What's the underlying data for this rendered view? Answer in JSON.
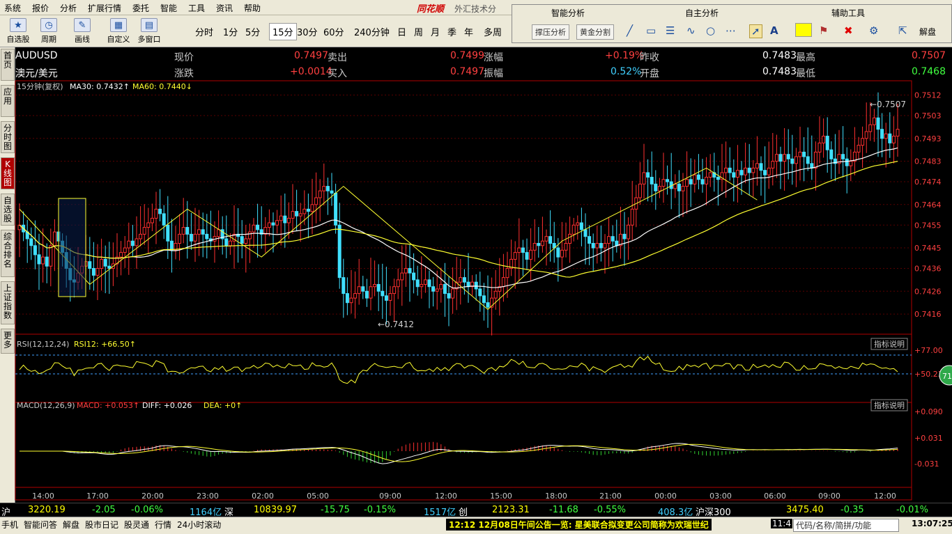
{
  "menu": {
    "items": [
      "系统",
      "报价",
      "分析",
      "扩展行情",
      "委托",
      "智能",
      "工具",
      "资讯",
      "帮助"
    ],
    "brand": "同花顺",
    "title": "外汇技术分"
  },
  "toolbar": {
    "buttons": [
      {
        "label": "自选股",
        "icon": "★"
      },
      {
        "label": "周期",
        "icon": "◷"
      },
      {
        "label": "画线",
        "icon": "✎"
      },
      {
        "label": "自定义",
        "icon": "▦"
      },
      {
        "label": "多窗口",
        "icon": "▤"
      }
    ],
    "periods": [
      "分时",
      "1分",
      "5分",
      "15分",
      "30分",
      "60分",
      "240分钟",
      "日",
      "周",
      "月",
      "季",
      "年",
      "多周"
    ],
    "active_period": "15分"
  },
  "panel": {
    "smart": "智能分析",
    "self": "自主分析",
    "aux": "辅助工具",
    "btn1": "撑压分析",
    "btn2": "黄金分割",
    "text_tool": "A",
    "layout": "解盘"
  },
  "left_tabs": [
    "首页",
    "应用",
    "分时图",
    "K线图",
    "自选股",
    "综合排名",
    "上证指数",
    "更多"
  ],
  "quote": {
    "code": "AUDUSD",
    "name": "澳元/美元",
    "labels": [
      "现价",
      "卖出",
      "涨幅",
      "昨收",
      "最高",
      "涨跌",
      "买入",
      "振幅",
      "开盘",
      "最低"
    ],
    "now": "0.7497",
    "sell": "0.7499",
    "pct": "+0.19%",
    "prev": "0.7483",
    "high": "0.7507",
    "chg": "+0.0014",
    "buy": "0.7497",
    "amp": "0.52%",
    "open": "0.7483",
    "low": "0.7468"
  },
  "main_legend": {
    "period": "15分钟(复权)",
    "ma30": "MA30: 0.7432",
    "ma60": "MA60: 0.7440"
  },
  "annotations": {
    "hi": "0.7507",
    "lo": "0.7412"
  },
  "rsi_legend": {
    "name": "RSI(12,12,24)",
    "val": "RSI12: +66.50",
    "help": "指标说明",
    "badge": "71"
  },
  "macd_legend": {
    "name": "MACD(12,26,9)",
    "macd": "MACD: +0.053",
    "diff": "DIFF: +0.026",
    "dea": "DEA: +0",
    "help": "指标说明"
  },
  "status": {
    "sh_label": "沪",
    "sh_idx": "3220.19",
    "sh_chg": "-2.05",
    "sh_pct": "-0.06%",
    "sh_amt": "1164亿",
    "sz_label": "深",
    "sz_idx": "10839.97",
    "sz_chg": "-15.75",
    "sz_pct": "-0.15%",
    "sz_amt": "1517亿",
    "cy_label": "创",
    "cy_idx": "2123.31",
    "cy_chg": "-11.68",
    "cy_pct": "-0.55%",
    "cy_amt": "408.3亿",
    "hs_label": "沪深300",
    "hs_idx": "3475.40",
    "hs_chg": "-0.35",
    "hs_pct": "-0.01%"
  },
  "taskbar": {
    "items": [
      "手机",
      "智能问答",
      "解盘",
      "股市日记",
      "股灵通",
      "行情",
      "24小时滚动"
    ],
    "news": "12:12 12月08日午间公告一览: 星美联合拟变更公司简称为欢瑞世纪",
    "time_short": "11:4",
    "search": "代码/名称/简拼/功能",
    "clock": "13:07:25"
  },
  "chart_data": {
    "type": "candlestick",
    "symbol": "AUDUSD",
    "x_ticks": [
      "14:00",
      "17:00",
      "20:00",
      "23:00",
      "02:00",
      "05:00",
      "09:00",
      "12:00",
      "15:00",
      "18:00",
      "21:00",
      "00:00",
      "03:00",
      "06:00",
      "09:00",
      "12:00"
    ],
    "y_ticks": [
      "0.7512",
      "0.7503",
      "0.7493",
      "0.7483",
      "0.7474",
      "0.7464",
      "0.7455",
      "0.7445",
      "0.7436",
      "0.7426",
      "0.7416"
    ],
    "ylim": [
      0.7409,
      0.7514
    ],
    "close": [
      0.7455,
      0.7452,
      0.7449,
      0.7446,
      0.7442,
      0.7438,
      0.7441,
      0.7437,
      0.7446,
      0.7452,
      0.7448,
      0.7443,
      0.7436,
      0.7431,
      0.743,
      0.7434,
      0.7437,
      0.7439,
      0.7436,
      0.7433,
      0.7436,
      0.744,
      0.7437,
      0.7436,
      0.7438,
      0.7441,
      0.7443,
      0.7445,
      0.7448,
      0.7446,
      0.7449,
      0.7451,
      0.7454,
      0.7456,
      0.7458,
      0.7462,
      0.746,
      0.7455,
      0.7448,
      0.7444,
      0.7447,
      0.7451,
      0.7454,
      0.7451,
      0.7448,
      0.7451,
      0.7453,
      0.7451,
      0.7449,
      0.7448,
      0.745,
      0.7453,
      0.7449,
      0.7446,
      0.7448,
      0.7451,
      0.745,
      0.7447,
      0.7449,
      0.7452,
      0.7455,
      0.7453,
      0.7451,
      0.7454,
      0.7456,
      0.7455,
      0.7457,
      0.7459,
      0.7456,
      0.7458,
      0.7461,
      0.7459,
      0.746,
      0.7462,
      0.7461,
      0.7464,
      0.7467,
      0.747,
      0.7472,
      0.747,
      0.7469,
      0.7455,
      0.7432,
      0.7425,
      0.7421,
      0.7423,
      0.7425,
      0.7428,
      0.7426,
      0.7423,
      0.7428,
      0.7429,
      0.7426,
      0.7424,
      0.7422,
      0.7425,
      0.7428,
      0.7431,
      0.7434,
      0.7436,
      0.7434,
      0.7431,
      0.7428,
      0.7429,
      0.7431,
      0.7428,
      0.7426,
      0.7427,
      0.7429,
      0.7425,
      0.7423,
      0.7427,
      0.743,
      0.7432,
      0.743,
      0.7428,
      0.743,
      0.7427,
      0.7424,
      0.7421,
      0.7419,
      0.7423,
      0.7426,
      0.7428,
      0.7432,
      0.7436,
      0.744,
      0.7443,
      0.7445,
      0.7443,
      0.744,
      0.7444,
      0.7447,
      0.7446,
      0.7448,
      0.745,
      0.7447,
      0.7445,
      0.7441,
      0.7444,
      0.7447,
      0.7451,
      0.7455,
      0.7456,
      0.7453,
      0.745,
      0.7447,
      0.7445,
      0.7447,
      0.7445,
      0.7447,
      0.745,
      0.7448,
      0.7446,
      0.7451,
      0.7449,
      0.7455,
      0.7462,
      0.7467,
      0.7473,
      0.7478,
      0.7476,
      0.7473,
      0.747,
      0.7472,
      0.7475,
      0.7474,
      0.7471,
      0.7473,
      0.747,
      0.7472,
      0.7475,
      0.7473,
      0.7477,
      0.7475,
      0.7473,
      0.7476,
      0.7478,
      0.7476,
      0.7475,
      0.7478,
      0.748,
      0.7478,
      0.7476,
      0.7479,
      0.7477,
      0.748,
      0.7478,
      0.748,
      0.7482,
      0.7479,
      0.7477,
      0.748,
      0.7483,
      0.7486,
      0.7483,
      0.7486,
      0.7484,
      0.7482,
      0.7485,
      0.7487,
      0.7485,
      0.7482,
      0.748,
      0.7487,
      0.7491,
      0.7494,
      0.7488,
      0.7484,
      0.7482,
      0.7486,
      0.7484,
      0.7481,
      0.7483,
      0.7487,
      0.749,
      0.7493,
      0.7496,
      0.7499,
      0.7502,
      0.7497,
      0.7493,
      0.7495,
      0.7491,
      0.7494,
      0.7497
    ],
    "high": 0.7507,
    "low": 0.7412
  }
}
